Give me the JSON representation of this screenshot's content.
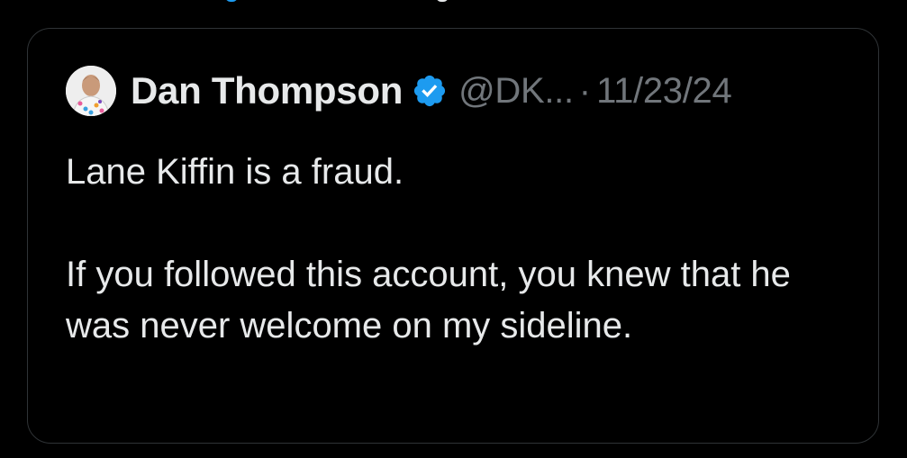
{
  "tweet": {
    "display_name": "Dan Thompson",
    "handle": "@DK...",
    "separator": "·",
    "date": "11/23/24",
    "verified": true,
    "line1": "Lane Kiffin is a fraud.",
    "line2": "If you followed this account, you knew that he was never welcome on my sideline."
  },
  "icons": {
    "verified": "verified-badge-icon",
    "avatar": "profile-avatar"
  },
  "colors": {
    "background": "#000000",
    "border": "#2f3336",
    "text_primary": "#e7e9ea",
    "text_secondary": "#71767b",
    "verified_blue": "#1d9bf0"
  }
}
